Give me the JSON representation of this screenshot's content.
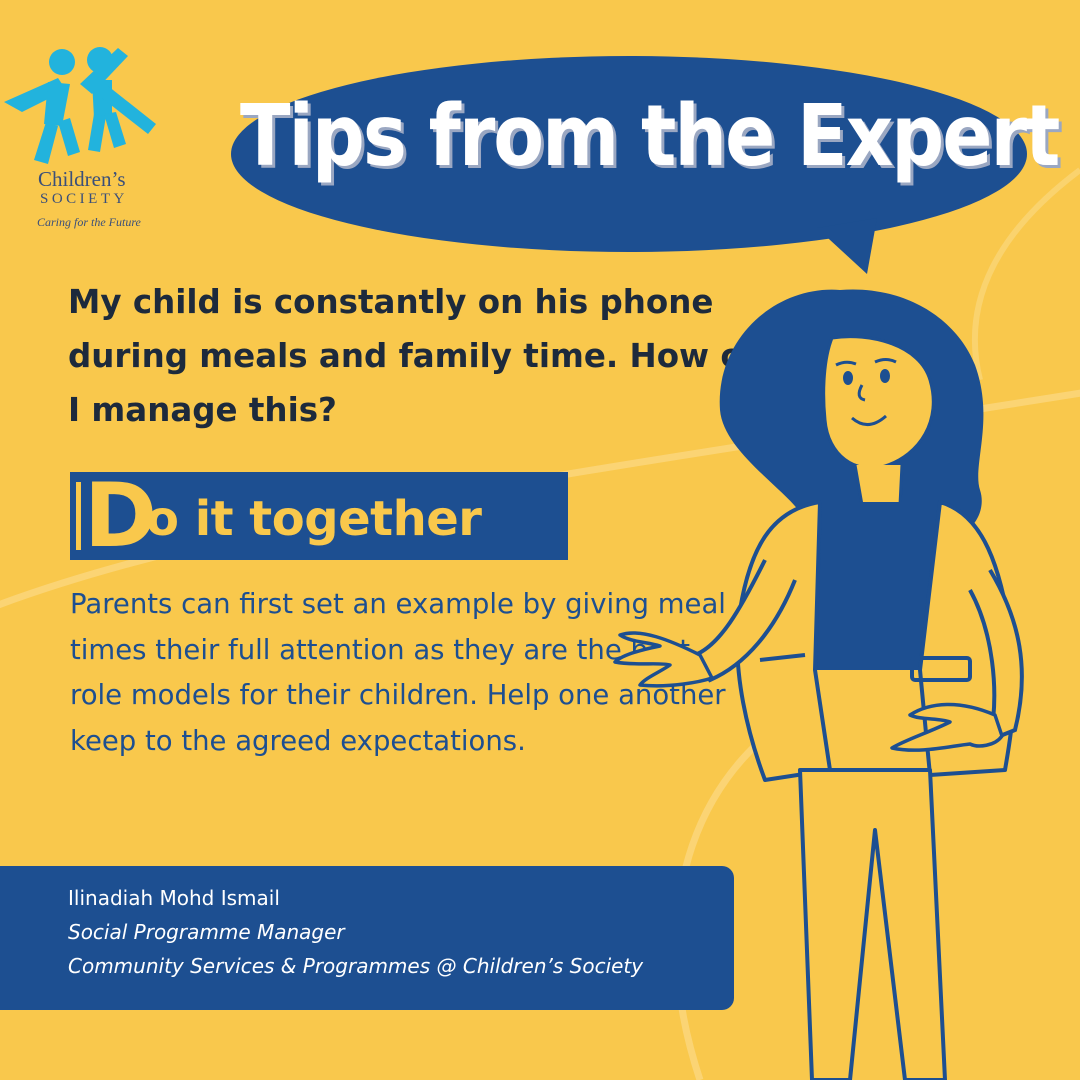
{
  "logo": {
    "name": "Children’s",
    "name_sub": "SOCIETY",
    "tagline": "Caring for the Future",
    "figures_icon": "two-children-holding-hands-icon",
    "color": "#22b3dd"
  },
  "header": {
    "title": "Tips from the Expert",
    "bubble_color": "#1d4f91"
  },
  "question": "My child is constantly on his phone during meals and family time. How can I manage this?",
  "tip": {
    "heading_initial": "D",
    "heading_rest": "o it together",
    "body": "Parents can first set an example by giving meal times their full attention as they are the best role models for their children. Help one another keep to the agreed expectations."
  },
  "credit": {
    "name": "Ilinadiah Mohd Ismail",
    "role": "Social Programme Manager",
    "department": "Community Services & Programmes @ Children’s Society"
  },
  "illustration": "woman-gesturing-illustration",
  "colors": {
    "background": "#f9c84c",
    "primary": "#1d4f91",
    "text_dark": "#1d2a3c",
    "white": "#ffffff"
  }
}
